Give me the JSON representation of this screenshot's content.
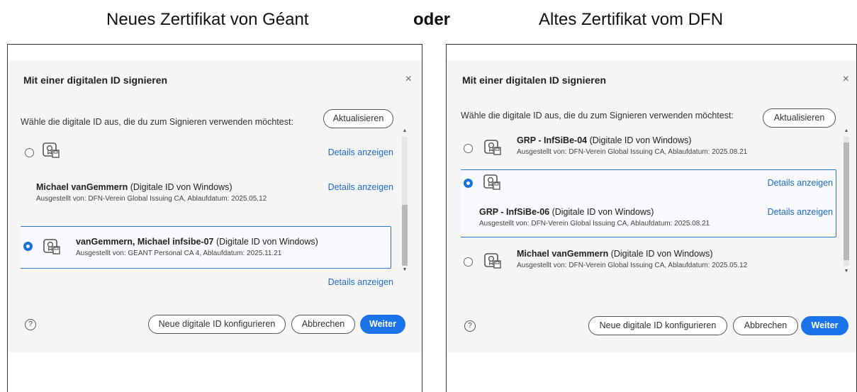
{
  "headings": {
    "left": "Neues Zertifikat von Géant",
    "middle": "oder",
    "right": "Altes Zertifikat vom DFN"
  },
  "dialog": {
    "title": "Mit einer digitalen ID signieren",
    "close": "×",
    "prompt": "Wähle die digitale ID aus, die du zum Signieren verwenden möchtest:",
    "refresh": "Aktualisieren",
    "details": "Details anzeigen",
    "type_suffix": "(Digitale ID von Windows)",
    "help": "?",
    "configure": "Neue digitale ID konfigurieren",
    "cancel": "Abbrechen",
    "next": "Weiter",
    "scroll_up": "▲",
    "scroll_down": "▼"
  },
  "left_ids": [
    {
      "name": "Michael vanGemmern",
      "issuer": "Ausgestellt von: DFN-Verein Global Issuing CA, Ablaufdatum: 2025.05.12",
      "selected": false
    },
    {
      "name": "vanGemmern, Michael infsibe-07",
      "issuer": "Ausgestellt von: GEANT Personal CA 4, Ablaufdatum: 2025.11.21",
      "selected": true
    }
  ],
  "right_ids": [
    {
      "name": "GRP - InfSiBe-04",
      "issuer": "Ausgestellt von: DFN-Verein Global Issuing CA, Ablaufdatum: 2025.08.21",
      "selected": false
    },
    {
      "name": "GRP - InfSiBe-06",
      "issuer": "Ausgestellt von: DFN-Verein Global Issuing CA, Ablaufdatum: 2025.08.21",
      "selected": true
    },
    {
      "name": "Michael vanGemmern",
      "issuer": "Ausgestellt von: DFN-Verein Global Issuing CA, Ablaufdatum: 2025.05.12",
      "selected": false
    }
  ],
  "colors": {
    "accent": "#1a73e8",
    "link": "#1f6bc7",
    "dialog_bg": "#f5f5f5"
  }
}
